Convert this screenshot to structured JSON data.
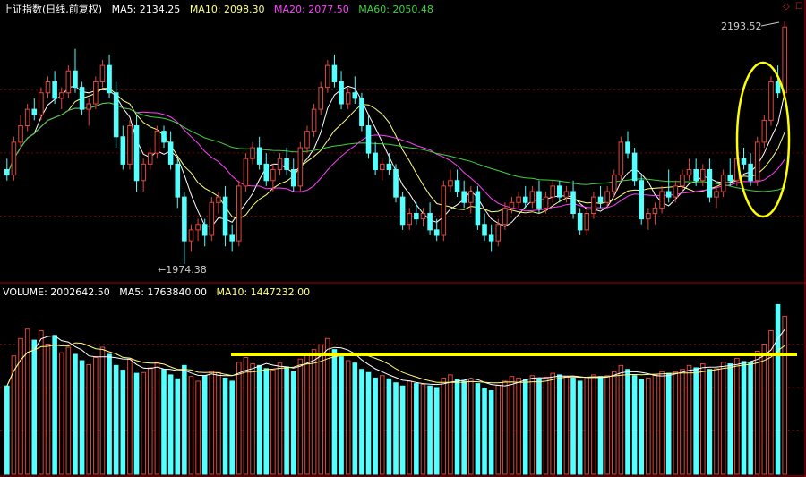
{
  "price_header": {
    "title": "上证指数(日线,前复权)",
    "ma5": "MA5: 2134.25",
    "ma10": "MA10: 2098.30",
    "ma20": "MA20: 2077.50",
    "ma60": "MA60: 2050.48"
  },
  "volume_header": {
    "volume": "VOLUME: 2002642.50",
    "ma5": "MA5: 1763840.00",
    "ma10": "MA10: 1447232.00"
  },
  "annotations": {
    "high_label": "2193.52",
    "low_label": "←1974.38"
  },
  "colors": {
    "up": "#e0463c",
    "down": "#54ffff",
    "ma5": "#ffffff",
    "ma10": "#ffff80",
    "ma20": "#ff40ff",
    "ma60": "#40d040",
    "highlight": "#ffff00",
    "grid": "#7a0000"
  },
  "icons": [
    "diamond-icon",
    "close-icon"
  ],
  "chart_data": [
    {
      "type": "candlestick",
      "title": "上证指数(日线,前复权)",
      "ylim": [
        1960,
        2200
      ],
      "series_names": [
        "MA5",
        "MA10",
        "MA20",
        "MA60"
      ],
      "ohlc": [
        [
          2060,
          2070,
          2050,
          2055
        ],
        [
          2055,
          2090,
          2050,
          2085
        ],
        [
          2085,
          2110,
          2080,
          2100
        ],
        [
          2100,
          2120,
          2095,
          2115
        ],
        [
          2115,
          2125,
          2105,
          2110
        ],
        [
          2110,
          2135,
          2105,
          2130
        ],
        [
          2130,
          2145,
          2125,
          2140
        ],
        [
          2140,
          2150,
          2120,
          2125
        ],
        [
          2125,
          2135,
          2115,
          2130
        ],
        [
          2130,
          2155,
          2125,
          2150
        ],
        [
          2150,
          2170,
          2130,
          2135
        ],
        [
          2135,
          2140,
          2110,
          2115
        ],
        [
          2115,
          2125,
          2100,
          2120
        ],
        [
          2120,
          2145,
          2115,
          2140
        ],
        [
          2140,
          2160,
          2135,
          2155
        ],
        [
          2155,
          2165,
          2125,
          2130
        ],
        [
          2130,
          2140,
          2080,
          2090
        ],
        [
          2090,
          2100,
          2060,
          2065
        ],
        [
          2065,
          2105,
          2060,
          2100
        ],
        [
          2100,
          2110,
          2040,
          2050
        ],
        [
          2050,
          2070,
          2040,
          2065
        ],
        [
          2065,
          2080,
          2060,
          2075
        ],
        [
          2075,
          2100,
          2070,
          2095
        ],
        [
          2095,
          2100,
          2080,
          2085
        ],
        [
          2085,
          2095,
          2060,
          2065
        ],
        [
          2065,
          2070,
          2025,
          2035
        ],
        [
          2035,
          2040,
          1974,
          1995
        ],
        [
          1995,
          2010,
          1985,
          2005
        ],
        [
          2005,
          2015,
          1995,
          2010
        ],
        [
          2010,
          2015,
          1990,
          2000
        ],
        [
          2000,
          2035,
          1995,
          2030
        ],
        [
          2030,
          2040,
          2020,
          2035
        ],
        [
          2035,
          2045,
          1990,
          2000
        ],
        [
          2000,
          2010,
          1985,
          1995
        ],
        [
          1995,
          2050,
          1990,
          2045
        ],
        [
          2045,
          2075,
          2040,
          2070
        ],
        [
          2070,
          2085,
          2065,
          2080
        ],
        [
          2080,
          2090,
          2060,
          2065
        ],
        [
          2065,
          2075,
          2045,
          2050
        ],
        [
          2050,
          2065,
          2040,
          2060
        ],
        [
          2060,
          2075,
          2055,
          2070
        ],
        [
          2070,
          2080,
          2055,
          2060
        ],
        [
          2060,
          2070,
          2040,
          2045
        ],
        [
          2045,
          2085,
          2040,
          2080
        ],
        [
          2080,
          2100,
          2075,
          2095
        ],
        [
          2095,
          2120,
          2090,
          2115
        ],
        [
          2115,
          2140,
          2110,
          2135
        ],
        [
          2135,
          2160,
          2130,
          2155
        ],
        [
          2155,
          2165,
          2135,
          2140
        ],
        [
          2140,
          2150,
          2115,
          2120
        ],
        [
          2120,
          2135,
          2115,
          2130
        ],
        [
          2130,
          2145,
          2120,
          2125
        ],
        [
          2125,
          2130,
          2095,
          2100
        ],
        [
          2100,
          2110,
          2070,
          2075
        ],
        [
          2075,
          2085,
          2055,
          2060
        ],
        [
          2060,
          2070,
          2050,
          2065
        ],
        [
          2065,
          2075,
          2055,
          2060
        ],
        [
          2060,
          2065,
          2030,
          2035
        ],
        [
          2035,
          2040,
          2005,
          2010
        ],
        [
          2010,
          2025,
          2005,
          2020
        ],
        [
          2020,
          2030,
          2010,
          2015
        ],
        [
          2015,
          2025,
          2008,
          2020
        ],
        [
          2020,
          2030,
          2000,
          2005
        ],
        [
          2005,
          2015,
          1995,
          2000
        ],
        [
          2000,
          2050,
          1995,
          2045
        ],
        [
          2045,
          2060,
          2040,
          2050
        ],
        [
          2050,
          2060,
          2035,
          2040
        ],
        [
          2040,
          2050,
          2025,
          2030
        ],
        [
          2030,
          2045,
          2020,
          2040
        ],
        [
          2040,
          2045,
          2005,
          2010
        ],
        [
          2010,
          2020,
          1995,
          2000
        ],
        [
          2000,
          2010,
          1985,
          1995
        ],
        [
          1995,
          2015,
          1990,
          2010
        ],
        [
          2010,
          2030,
          2005,
          2025
        ],
        [
          2025,
          2035,
          2020,
          2030
        ],
        [
          2030,
          2040,
          2025,
          2035
        ],
        [
          2035,
          2045,
          2025,
          2030
        ],
        [
          2030,
          2045,
          2025,
          2040
        ],
        [
          2040,
          2050,
          2020,
          2025
        ],
        [
          2025,
          2040,
          2020,
          2035
        ],
        [
          2035,
          2050,
          2030,
          2045
        ],
        [
          2045,
          2050,
          2030,
          2035
        ],
        [
          2035,
          2045,
          2030,
          2040
        ],
        [
          2040,
          2050,
          2015,
          2020
        ],
        [
          2020,
          2025,
          2000,
          2005
        ],
        [
          2005,
          2025,
          2000,
          2020
        ],
        [
          2020,
          2040,
          2015,
          2035
        ],
        [
          2035,
          2045,
          2025,
          2030
        ],
        [
          2030,
          2045,
          2025,
          2040
        ],
        [
          2040,
          2060,
          2035,
          2055
        ],
        [
          2055,
          2090,
          2050,
          2085
        ],
        [
          2085,
          2095,
          2070,
          2075
        ],
        [
          2075,
          2080,
          2045,
          2050
        ],
        [
          2050,
          2055,
          2010,
          2015
        ],
        [
          2015,
          2025,
          2005,
          2020
        ],
        [
          2020,
          2030,
          2010,
          2025
        ],
        [
          2025,
          2045,
          2020,
          2040
        ],
        [
          2040,
          2060,
          2030,
          2035
        ],
        [
          2035,
          2050,
          2030,
          2045
        ],
        [
          2045,
          2060,
          2040,
          2055
        ],
        [
          2055,
          2070,
          2050,
          2060
        ],
        [
          2060,
          2070,
          2045,
          2050
        ],
        [
          2050,
          2065,
          2045,
          2060
        ],
        [
          2060,
          2070,
          2030,
          2035
        ],
        [
          2035,
          2045,
          2025,
          2040
        ],
        [
          2040,
          2060,
          2035,
          2055
        ],
        [
          2055,
          2070,
          2045,
          2050
        ],
        [
          2050,
          2075,
          2045,
          2070
        ],
        [
          2070,
          2080,
          2060,
          2065
        ],
        [
          2065,
          2075,
          2045,
          2050
        ],
        [
          2050,
          2090,
          2045,
          2085
        ],
        [
          2085,
          2110,
          2080,
          2105
        ],
        [
          2105,
          2145,
          2100,
          2140
        ],
        [
          2140,
          2155,
          2125,
          2130
        ],
        [
          2130,
          2195,
          2125,
          2190
        ]
      ],
      "volume": [
        1120000,
        1500000,
        1720000,
        1840000,
        1700000,
        1820000,
        1650000,
        1760000,
        1540000,
        1610000,
        1520000,
        1440000,
        1390000,
        1480000,
        1610000,
        1520000,
        1380000,
        1320000,
        1460000,
        1280000,
        1290000,
        1350000,
        1420000,
        1330000,
        1260000,
        1210000,
        1380000,
        1240000,
        1180000,
        1250000,
        1310000,
        1290000,
        1220000,
        1180000,
        1420000,
        1480000,
        1400000,
        1380000,
        1340000,
        1320000,
        1410000,
        1360000,
        1300000,
        1460000,
        1520000,
        1580000,
        1640000,
        1720000,
        1580000,
        1490000,
        1440000,
        1410000,
        1330000,
        1290000,
        1220000,
        1250000,
        1210000,
        1160000,
        1120000,
        1180000,
        1150000,
        1140000,
        1120000,
        1100000,
        1220000,
        1260000,
        1200000,
        1180000,
        1210000,
        1150000,
        1090000,
        1060000,
        1130000,
        1180000,
        1240000,
        1220000,
        1200000,
        1250000,
        1210000,
        1230000,
        1280000,
        1260000,
        1240000,
        1220000,
        1180000,
        1230000,
        1260000,
        1240000,
        1250000,
        1300000,
        1380000,
        1330000,
        1250000,
        1200000,
        1220000,
        1260000,
        1300000,
        1280000,
        1300000,
        1330000,
        1380000,
        1350000,
        1400000,
        1330000,
        1340000,
        1420000,
        1400000,
        1470000,
        1430000,
        1420000,
        1560000,
        1650000,
        1820000,
        2150000,
        2002642
      ],
      "vol_ylim": [
        0,
        2200000
      ],
      "highlight_level": 1520000,
      "annotations": [
        "2193.52",
        "1974.38"
      ]
    }
  ]
}
